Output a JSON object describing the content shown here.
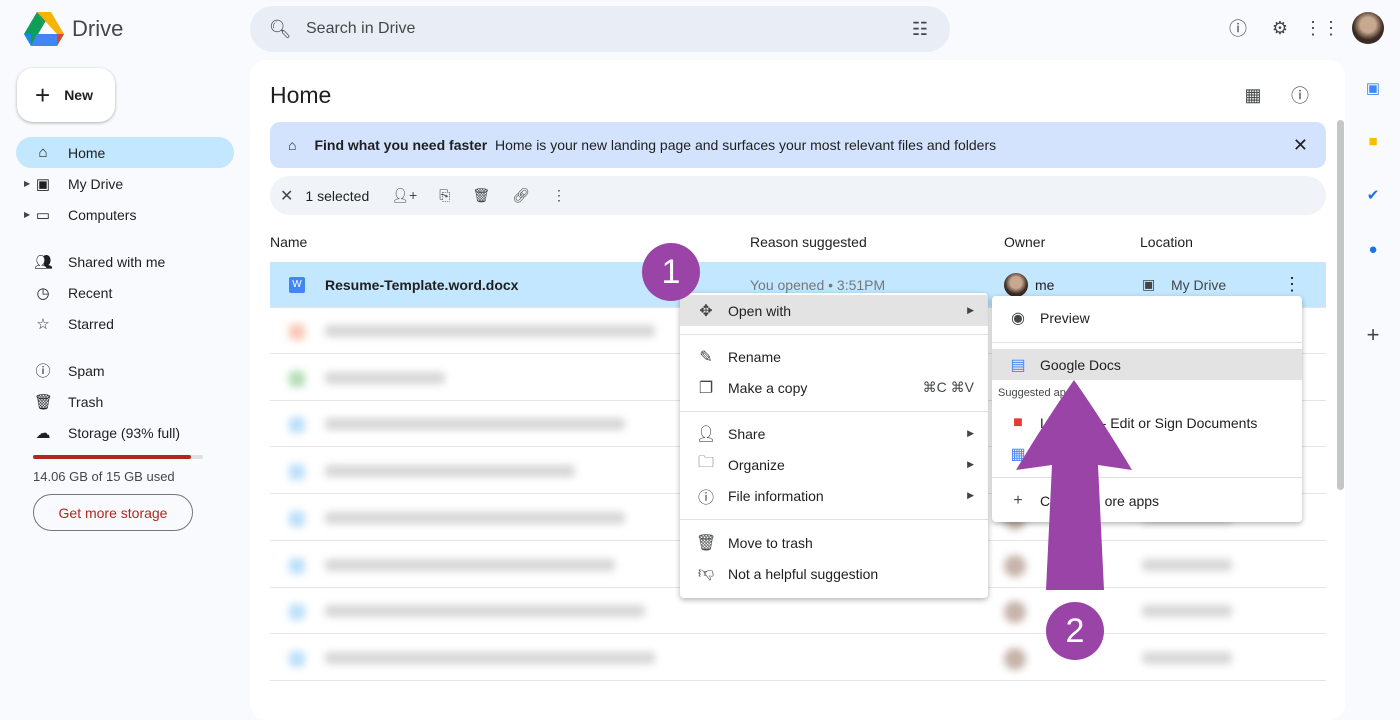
{
  "app": {
    "name": "Drive"
  },
  "search": {
    "placeholder": "Search in Drive"
  },
  "sidebar": {
    "new_label": "New",
    "items": [
      {
        "label": "Home",
        "icon": "home-icon"
      },
      {
        "label": "My Drive",
        "icon": "my-drive-icon"
      },
      {
        "label": "Computers",
        "icon": "computers-icon"
      },
      {
        "label": "Shared with me",
        "icon": "people-icon"
      },
      {
        "label": "Recent",
        "icon": "clock-icon"
      },
      {
        "label": "Starred",
        "icon": "star-icon"
      },
      {
        "label": "Spam",
        "icon": "spam-icon"
      },
      {
        "label": "Trash",
        "icon": "trash-icon"
      },
      {
        "label": "Storage (93% full)",
        "icon": "cloud-icon"
      }
    ],
    "storage_used": "14.06 GB of 15 GB used",
    "storage_percent": 93,
    "get_more": "Get more storage"
  },
  "main": {
    "title": "Home",
    "banner": {
      "title": "Find what you need faster",
      "text": "Home is your new landing page and surfaces your most relevant files and folders"
    },
    "selection": {
      "count_label": "1 selected"
    },
    "columns": [
      "Name",
      "Reason suggested",
      "Owner",
      "Location"
    ],
    "selected_file": {
      "name": "Resume-Template.word.docx",
      "reason": "You opened • 3:51PM",
      "owner": "me",
      "location": "My Drive"
    }
  },
  "context_menu": {
    "items": [
      {
        "label": "Open with",
        "icon": "open-with-icon"
      },
      {
        "label": "Rename",
        "icon": "rename-icon"
      },
      {
        "label": "Make a copy",
        "icon": "copy-icon",
        "shortcut": "⌘C ⌘V"
      },
      {
        "label": "Share",
        "icon": "share-icon"
      },
      {
        "label": "Organize",
        "icon": "folder-icon"
      },
      {
        "label": "File information",
        "icon": "info-icon"
      },
      {
        "label": "Move to trash",
        "icon": "trash-icon"
      },
      {
        "label": "Not a helpful suggestion",
        "icon": "thumbs-down-icon"
      }
    ]
  },
  "submenu": {
    "preview": "Preview",
    "google_docs": "Google Docs",
    "suggested_header": "Suggested ap",
    "app1": "L              - Edit or Sign Documents",
    "more": "C              ore apps"
  },
  "annotations": {
    "step1": "1",
    "step2": "2",
    "color": "#9b44a8"
  },
  "colors": {
    "selected_row": "#c2e7ff",
    "banner": "#d3e3fd",
    "storage": "#b3261e"
  }
}
